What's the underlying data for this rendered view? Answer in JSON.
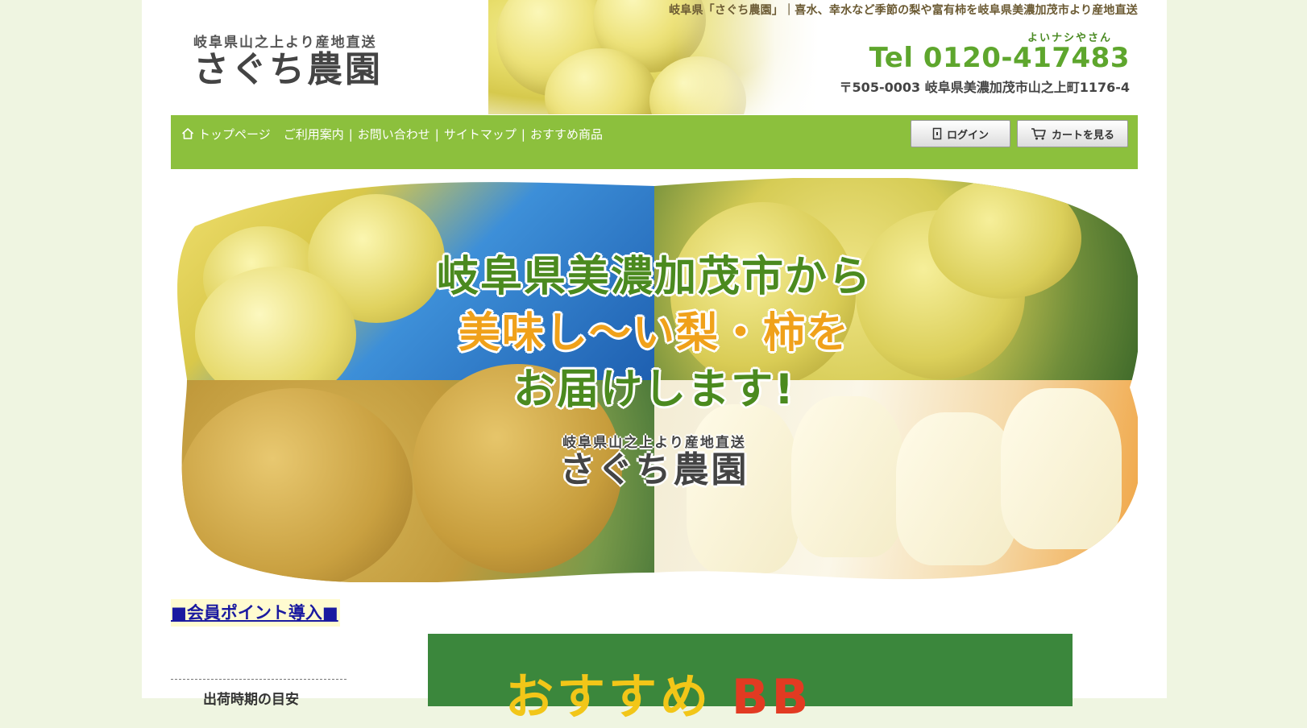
{
  "header": {
    "tagline": "岐阜県「さぐち農園」｜喜水、幸水など季節の梨や富有柿を岐阜県美濃加茂市より産地直送",
    "logo_sub": "岐阜県山之上より産地直送",
    "logo_main": "さぐち農園",
    "tel_ruby": "よいナシやさん",
    "tel": "Tel 0120-417483",
    "address": "〒505-0003 岐阜県美濃加茂市山之上町1176-4"
  },
  "nav": {
    "home": "トップページ",
    "guide": "ご利用案内",
    "contact": "お問い合わせ",
    "sitemap": "サイトマップ",
    "recommended": "おすすめ商品",
    "login": "ログイン",
    "cart": "カートを見る"
  },
  "hero": {
    "line1": "岐阜県美濃加茂市から",
    "line2": "美味し〜い梨・柿を",
    "line3": "お届けします!",
    "logo_sub": "岐阜県山之上より産地直送",
    "logo_main": "さぐち農園"
  },
  "sidebar": {
    "member_link": "■会員ポイント導入■",
    "shipping_heading": "出荷時期の目安"
  },
  "banner": {
    "text_a": "おすすめ",
    "text_b": "BB"
  },
  "colors": {
    "page_bg": "#eff5e1",
    "nav_green": "#8cc03d",
    "tel_green": "#5ea62d",
    "hero_green": "#4b8a1f",
    "hero_orange": "#f0a11a",
    "link_blue": "#1a1aa0",
    "banner_green": "#3b873c"
  },
  "icons": [
    "home-icon",
    "login-icon",
    "cart-icon"
  ]
}
